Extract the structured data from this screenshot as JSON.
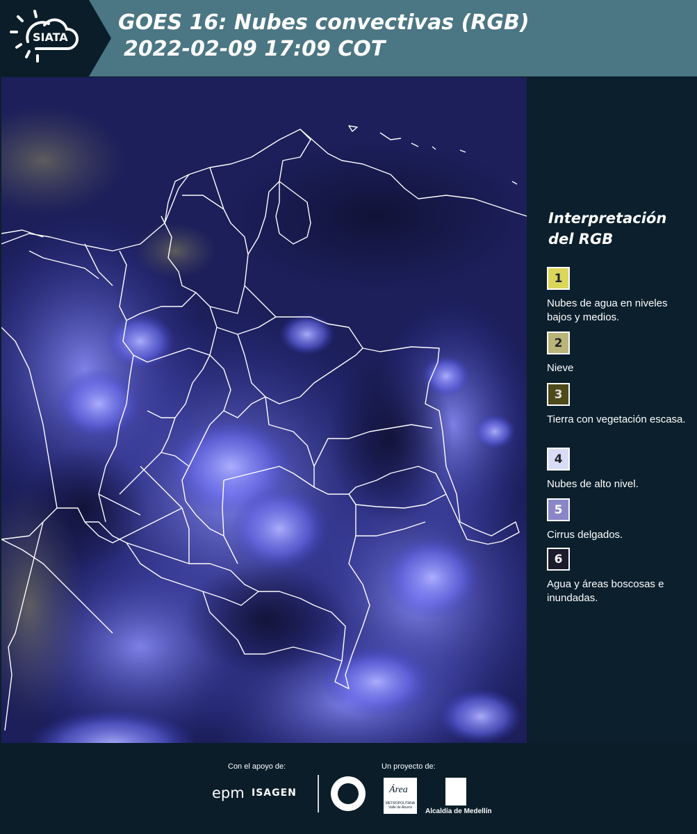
{
  "header": {
    "logo_text": "SIATA",
    "title_line1": "GOES 16: Nubes convectivas (RGB)",
    "title_line2": "2022-02-09 17:09 COT",
    "background_color": "#4b7683"
  },
  "map": {
    "description_icon": "satellite-rgb-image",
    "boundary_color": "#ffffff"
  },
  "legend": {
    "title": "Interpretación del RGB",
    "items": [
      {
        "number": "1",
        "label": "Nubes de agua en niveles bajos y medios.",
        "color": "#d9d65a"
      },
      {
        "number": "2",
        "label": "Nieve",
        "color": "#b9b477"
      },
      {
        "number": "3",
        "label": "Tierra con vegetación escasa.",
        "color": "#4e4a1a"
      },
      {
        "number": "4",
        "label": "Nubes de alto nivel.",
        "color": "#d9dcf6"
      },
      {
        "number": "5",
        "label": "Cirrus delgados.",
        "color": "#8a86c8"
      },
      {
        "number": "6",
        "label": "Agua y áreas boscosas e inundadas.",
        "color": "#1b1b2c"
      }
    ]
  },
  "footer": {
    "support_label": "Con el apoyo de:",
    "project_label": "Un proyecto de:",
    "sponsor1": "epm",
    "sponsor2": "ISAGEN",
    "partner_area": "Área",
    "partner_area_sub": "METROPOLITANA Valle de Aburrá",
    "partner_alcaldia": "Alcaldía de Medellín"
  }
}
